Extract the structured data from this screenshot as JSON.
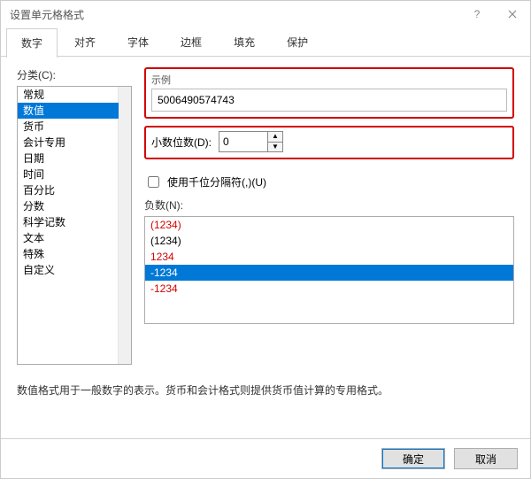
{
  "window": {
    "title": "设置单元格格式"
  },
  "tabs": [
    "数字",
    "对齐",
    "字体",
    "边框",
    "填充",
    "保护"
  ],
  "active_tab": 0,
  "category": {
    "label": "分类(C):",
    "items": [
      "常规",
      "数值",
      "货币",
      "会计专用",
      "日期",
      "时间",
      "百分比",
      "分数",
      "科学记数",
      "文本",
      "特殊",
      "自定义"
    ],
    "selected_index": 1
  },
  "sample": {
    "label": "示例",
    "value": "5006490574743"
  },
  "decimal": {
    "label": "小数位数(D):",
    "value": "0"
  },
  "thousands": {
    "checked": false,
    "label": "使用千位分隔符(,)(U)"
  },
  "negative": {
    "label": "负数(N):",
    "items": [
      {
        "text": "(1234)",
        "color": "red"
      },
      {
        "text": "(1234)",
        "color": "black"
      },
      {
        "text": "1234",
        "color": "red"
      },
      {
        "text": "-1234",
        "color": "black"
      },
      {
        "text": "-1234",
        "color": "red"
      }
    ],
    "selected_index": 3
  },
  "description": "数值格式用于一般数字的表示。货币和会计格式则提供货币值计算的专用格式。",
  "buttons": {
    "ok": "确定",
    "cancel": "取消"
  },
  "highlight_color": "#d20000"
}
